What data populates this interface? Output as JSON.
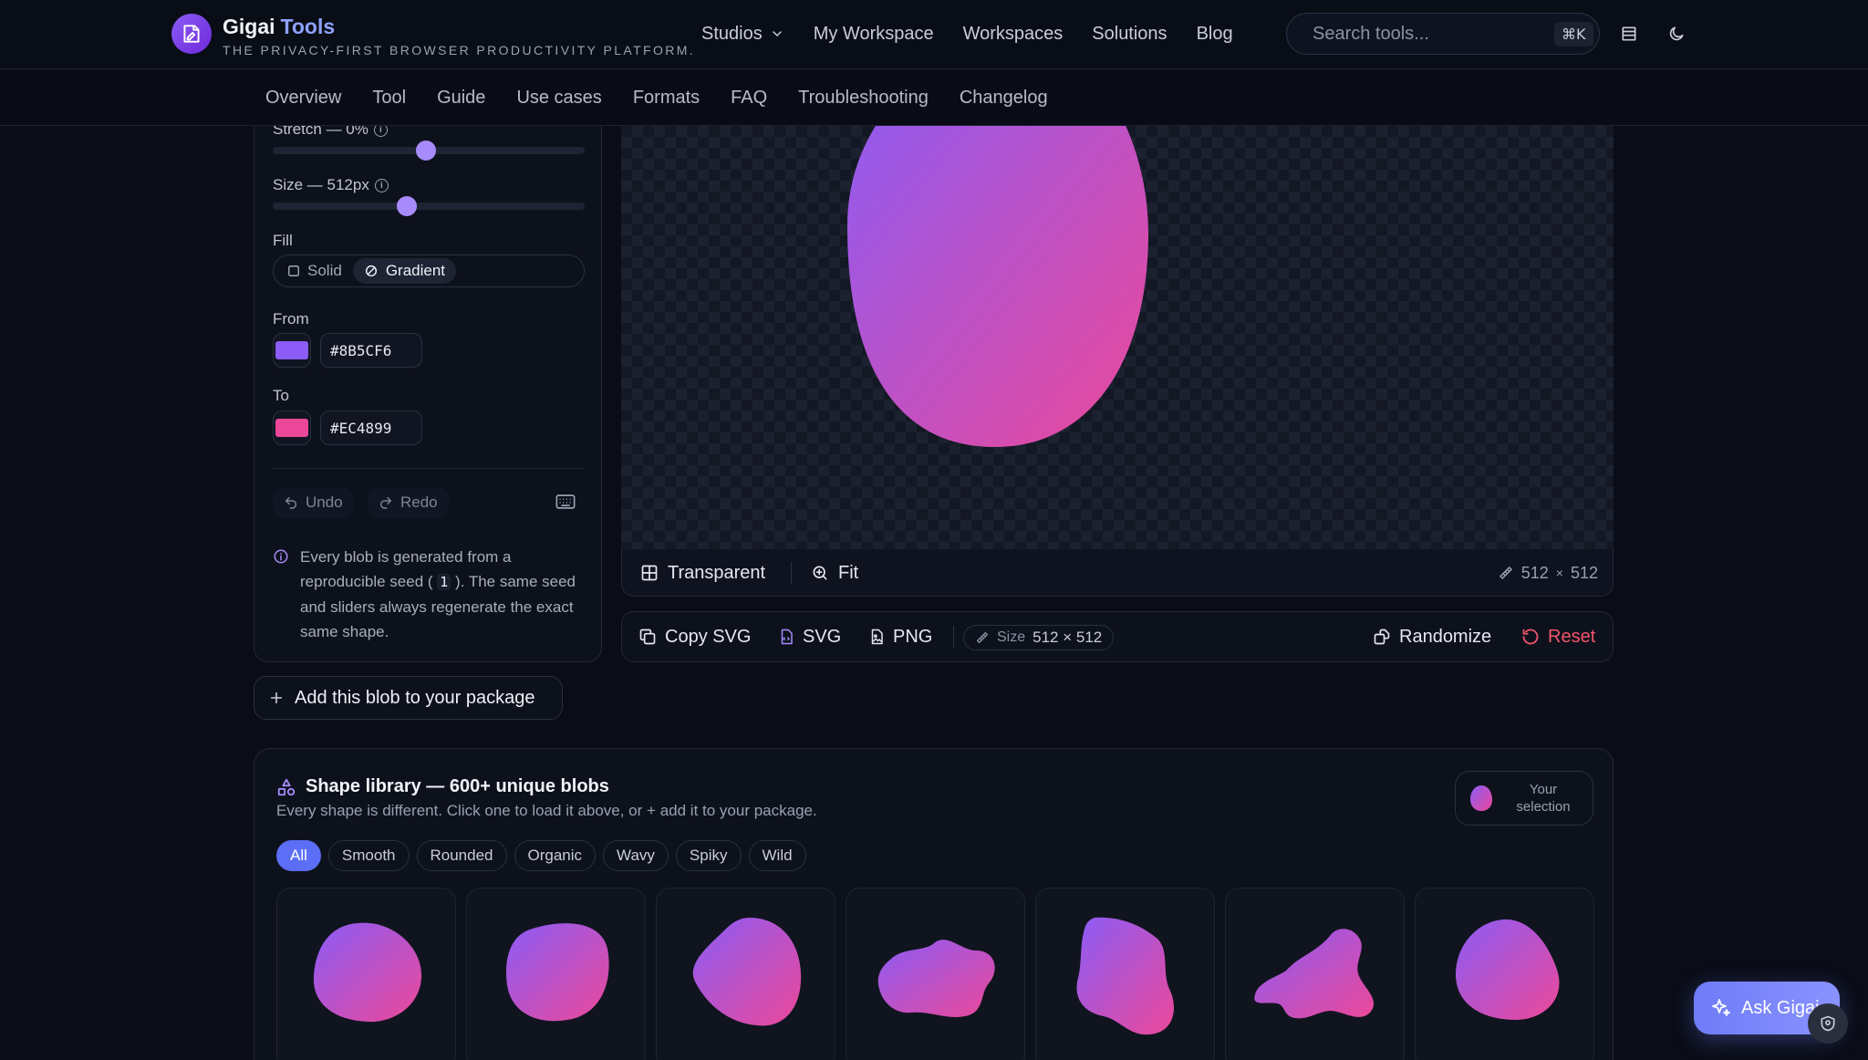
{
  "brand": {
    "name": "Gigai",
    "name_accent": "Tools",
    "tagline": "THE PRIVACY-FIRST BROWSER PRODUCTIVITY PLATFORM."
  },
  "topnav": {
    "studios": "Studios",
    "my_workspace": "My Workspace",
    "workspaces": "Workspaces",
    "solutions": "Solutions",
    "blog": "Blog"
  },
  "search": {
    "placeholder": "Search tools...",
    "shortcut": "⌘K"
  },
  "subnav": {
    "overview": "Overview",
    "tool": "Tool",
    "guide": "Guide",
    "use_cases": "Use cases",
    "formats": "Formats",
    "faq": "FAQ",
    "troubleshooting": "Troubleshooting",
    "changelog": "Changelog"
  },
  "controls": {
    "stretch_label": "Stretch — 0%",
    "stretch_value": 0.49,
    "size_label": "Size — 512px",
    "size_value": 0.43,
    "fill_label": "Fill",
    "fill_solid": "Solid",
    "fill_gradient": "Gradient",
    "from_label": "From",
    "from_hex": "#8B5CF6",
    "to_label": "To",
    "to_hex": "#EC4899",
    "undo": "Undo",
    "redo": "Redo",
    "note_part1": "Every blob is generated from a reproducible seed (",
    "seed": "1",
    "note_part2": "). The same seed and sliders always regenerate the exact same shape."
  },
  "canvas": {
    "transparent_label": "Transparent",
    "fit_label": "Fit",
    "width": "512",
    "times": "×",
    "height": "512"
  },
  "actions": {
    "copy_svg": "Copy SVG",
    "svg": "SVG",
    "png": "PNG",
    "size_label": "Size",
    "size_value": "512 × 512",
    "randomize": "Randomize",
    "reset": "Reset"
  },
  "add_package": "Add this blob to your package",
  "library": {
    "title": "Shape library — 600+ unique blobs",
    "subtitle_part1": "Every shape is different. Click one to load it above, or",
    "subtitle_plus": "+",
    "subtitle_part2": "add it to your package.",
    "your_selection": "Your selection",
    "filters": [
      "All",
      "Smooth",
      "Rounded",
      "Organic",
      "Wavy",
      "Spiky",
      "Wild"
    ]
  },
  "ask": "Ask Gigai",
  "colors": {
    "gradient_from": "#8B5CF6",
    "gradient_to": "#EC4899",
    "accent": "#5B6EF5",
    "reset": "#F0556A"
  }
}
